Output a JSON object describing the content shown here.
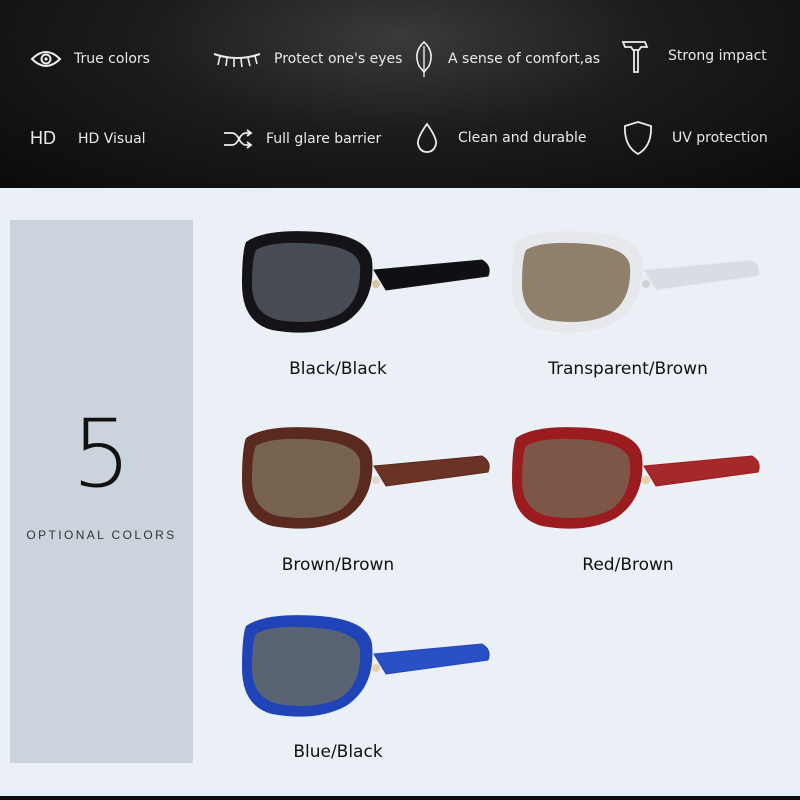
{
  "features": {
    "true_colors": "True colors",
    "protect_eyes": "Protect one's eyes",
    "comfort": "A sense of comfort,as",
    "strong_impact": "Strong impact",
    "hd_icon_text": "HD",
    "hd_visual": "HD Visual",
    "glare_barrier": "Full glare barrier",
    "clean_durable": "Clean and durable",
    "uv_protection": "UV protection"
  },
  "options": {
    "count": "5",
    "label": "OPTIONAL COLORS"
  },
  "variants": [
    {
      "caption": "Black/Black",
      "frame": "#141418",
      "lens": "#4a4e57",
      "arm": "#101014"
    },
    {
      "caption": "Transparent/Brown",
      "frame": "#e6e8ec",
      "lens": "#8a7964",
      "arm": "#d9dce2"
    },
    {
      "caption": "Brown/Brown",
      "frame": "#5a2a1e",
      "lens": "#7a6654",
      "arm": "#6b3226"
    },
    {
      "caption": "Red/Brown",
      "frame": "#9a1c1e",
      "lens": "#7b5a4a",
      "arm": "#a5292a"
    },
    {
      "caption": "Blue/Black",
      "frame": "#2044b8",
      "lens": "#5d6570",
      "arm": "#2a50c8"
    }
  ]
}
